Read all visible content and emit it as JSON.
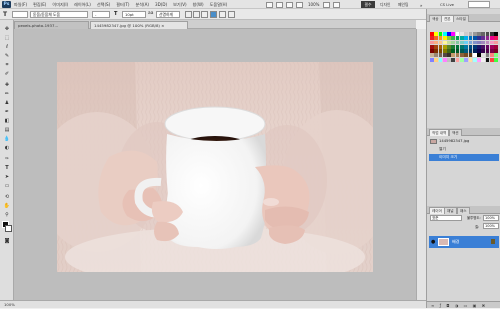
{
  "app": {
    "logo": "Ps"
  },
  "menus": [
    "파일(F)",
    "편집(E)",
    "이미지(I)",
    "레이어(L)",
    "선택(S)",
    "필터(T)",
    "분석(A)",
    "3D(D)",
    "보기(V)",
    "창(W)",
    "도움말(H)"
  ],
  "topbar": {
    "zoom": "100%",
    "workspace_active": "필수",
    "workspace_design": "디자인",
    "workspace_painting": "페인팅",
    "cs_live": "CS Live"
  },
  "options": {
    "tool_icon": "T",
    "font_family": "돋움/돋움체 도움",
    "font_style": "-",
    "font_size": "10pt",
    "antialias": "선명하게"
  },
  "document_tabs": [
    {
      "label": "pexels-photo-1937...",
      "active": false
    },
    {
      "label": "1445982347.jpg @ 100% (RGB/8) ×",
      "active": true
    }
  ],
  "status": {
    "zoom": "100%"
  },
  "panels": {
    "color_tabs": [
      "색상",
      "견본",
      "스타일"
    ],
    "history_tabs": [
      "작업 내역",
      "액션"
    ],
    "history": [
      {
        "label": "1445982347.jpg",
        "thumb": true
      },
      {
        "label": "열기",
        "thumb": false
      },
      {
        "label": "이미지 크기",
        "thumb": false,
        "selected": true
      }
    ],
    "layers_tabs": [
      "레이어",
      "채널",
      "패스"
    ],
    "blend_mode": "표준",
    "opacity_label": "불투명도:",
    "opacity": "100%",
    "fill_label": "칠:",
    "fill": "100%",
    "layer_name": "배경"
  },
  "colors": {
    "ui_bg": "#f0f0f0",
    "canvas_bg": "#bdbdbd",
    "selection": "#3a7fd6",
    "mug": "#ffffff",
    "coffee": "#3b1e12",
    "sweater": "#e9d6d0"
  },
  "swatches": [
    "#ff0000",
    "#ffff00",
    "#00ff00",
    "#00ffff",
    "#0000ff",
    "#ff00ff",
    "#ffffff",
    "#e6e6e6",
    "#cccccc",
    "#b3b3b3",
    "#999999",
    "#808080",
    "#666666",
    "#4d4d4d",
    "#333333",
    "#000000",
    "#ed1c24",
    "#f26522",
    "#f7941d",
    "#fff200",
    "#8dc63f",
    "#39b54a",
    "#00a651",
    "#00a99d",
    "#00aeef",
    "#0072bc",
    "#0054a6",
    "#2e3192",
    "#662d91",
    "#92278f",
    "#ec008c",
    "#ed145b",
    "#f6989d",
    "#f9ad81",
    "#fdc68a",
    "#fff799",
    "#c4df9b",
    "#a3d39c",
    "#82ca9d",
    "#7accc8",
    "#6dcff6",
    "#7da7d9",
    "#8393ca",
    "#8781bd",
    "#a187be",
    "#bd8cbf",
    "#f49ac2",
    "#f5989d",
    "#9e0b0f",
    "#a0410d",
    "#a36209",
    "#aba000",
    "#598527",
    "#1a7b30",
    "#007236",
    "#00746b",
    "#0076a3",
    "#004b80",
    "#003471",
    "#1b1464",
    "#440e62",
    "#630460",
    "#9e005d",
    "#9e0039",
    "#790000",
    "#7b2e00",
    "#7d4900",
    "#827b00",
    "#406618",
    "#005e20",
    "#005826",
    "#005952",
    "#005b7f",
    "#003663",
    "#002157",
    "#0d004c",
    "#32004b",
    "#4b0049",
    "#7b0046",
    "#7a0026",
    "#c7b299",
    "#998675",
    "#736357",
    "#534741",
    "#37302a",
    "#c69c6d",
    "#a67c52",
    "#8c6239",
    "#754c24",
    "#603913",
    "#ffffff",
    "#000000",
    "#e0e0e0",
    "#7f7f7f",
    "#ff8080",
    "#80ff80",
    "#8080ff",
    "#ffd280",
    "#80ffff",
    "#ff80ff",
    "#c0c0c0",
    "#404040",
    "#ffa0a0",
    "#a0ffa0",
    "#a0a0ff",
    "#ffe0a0",
    "#a0ffff",
    "#ffa0ff",
    "#f0f0f0",
    "#101010",
    "#ff4040",
    "#40ff40"
  ]
}
